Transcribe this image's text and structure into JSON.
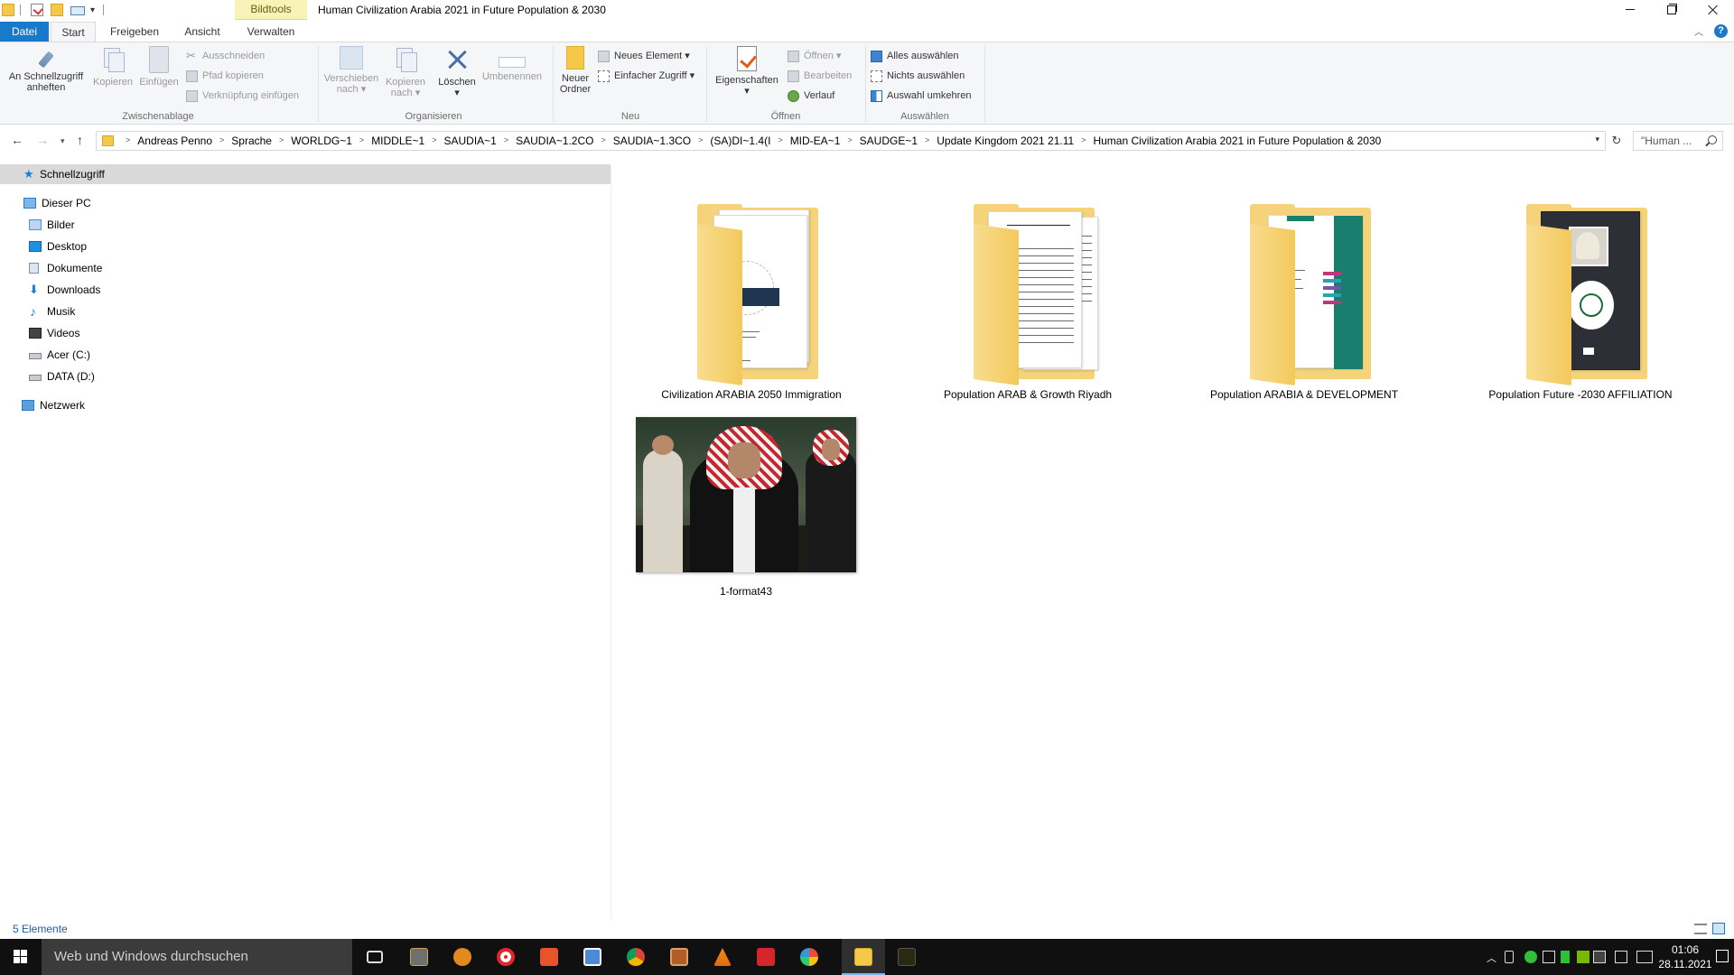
{
  "titlebar": {
    "context_tab": "Bildtools",
    "window_title": "Human Civilization Arabia 2021 in Future  Population & 2030"
  },
  "ribbon_tabs": {
    "datei": "Datei",
    "start": "Start",
    "freigeben": "Freigeben",
    "ansicht": "Ansicht",
    "verwalten": "Verwalten",
    "help": "?"
  },
  "ribbon": {
    "zwischenablage": {
      "label": "Zwischenablage",
      "pin": "An Schnellzugriff anheften",
      "pin_line1": "An Schnellzugriff",
      "pin_line2": "anheften",
      "copy": "Kopieren",
      "paste": "Einfügen",
      "cut": "Ausschneiden",
      "copy_path": "Pfad kopieren",
      "paste_shortcut": "Verknüpfung einfügen"
    },
    "organisieren": {
      "label": "Organisieren",
      "move_line1": "Verschieben",
      "move_line2": "nach",
      "copy_line1": "Kopieren",
      "copy_line2": "nach",
      "delete": "Löschen",
      "rename": "Umbenennen"
    },
    "neu": {
      "label": "Neu",
      "new_folder_line1": "Neuer",
      "new_folder_line2": "Ordner",
      "new_item": "Neues Element",
      "easy_access": "Einfacher Zugriff"
    },
    "oeffnen": {
      "label": "Öffnen",
      "properties": "Eigenschaften",
      "open": "Öffnen",
      "edit": "Bearbeiten",
      "history": "Verlauf"
    },
    "auswaehlen": {
      "label": "Auswählen",
      "select_all": "Alles auswählen",
      "select_none": "Nichts auswählen",
      "invert": "Auswahl umkehren"
    }
  },
  "address": {
    "crumbs": [
      "Andreas Penno",
      "Sprache",
      "WORLDG~1",
      "MIDDLE~1",
      "SAUDIA~1",
      "SAUDIA~1.2CO",
      "SAUDIA~1.3CO",
      "(SA)DI~1.4(I",
      "MID-EA~1",
      "SAUDGE~1",
      "Update Kingdom 2021 21.11",
      "Human Civilization Arabia 2021 in Future  Population & 2030"
    ],
    "search_placeholder": "\"Human ..."
  },
  "navpane": {
    "quick_access": "Schnellzugriff",
    "this_pc": "Dieser PC",
    "pictures": "Bilder",
    "desktop": "Desktop",
    "documents": "Dokumente",
    "downloads": "Downloads",
    "music": "Musik",
    "videos": "Videos",
    "drive_c": "Acer (C:)",
    "drive_d": "DATA (D:)",
    "network": "Netzwerk"
  },
  "files": [
    {
      "name": "Civilization ARABIA 2050 Immigration",
      "type": "folder"
    },
    {
      "name": "Population ARAB & Growth Riyadh",
      "type": "folder"
    },
    {
      "name": "Population ARABIA & DEVELOPMENT",
      "type": "folder"
    },
    {
      "name": "Population Future -2030 AFFILIATION",
      "type": "folder"
    },
    {
      "name": "1-format43",
      "type": "image"
    }
  ],
  "status": {
    "count": "5 Elemente"
  },
  "taskbar": {
    "search_placeholder": "Web und Windows durchsuchen",
    "time": "01:06",
    "date": "28.11.2021",
    "apps": [
      "task-view-icon",
      "photo-viewer-icon",
      "app-icon",
      "opera-icon",
      "pdf-app-icon",
      "photos-icon",
      "chrome-icon",
      "archive-icon",
      "vlc-icon",
      "acrobat-icon",
      "picasa-icon",
      "file-explorer-icon",
      "media-app-icon"
    ]
  },
  "colors": {
    "accent": "#1979ca",
    "context_tab": "#f8f4b8",
    "folder": "#f5d37a",
    "taskbar": "#101010"
  }
}
